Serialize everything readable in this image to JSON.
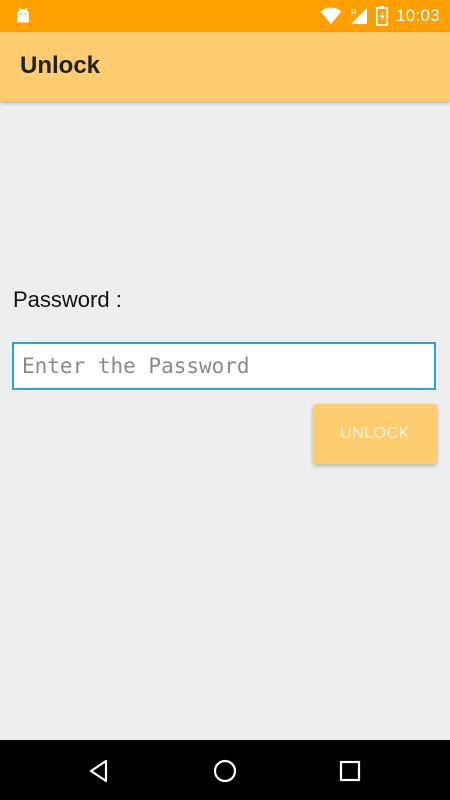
{
  "status_bar": {
    "time": "10:03",
    "icons": [
      "android-debug-icon",
      "wifi-icon",
      "signal-roaming-icon",
      "battery-icon"
    ],
    "background": "#ffa000"
  },
  "app_bar": {
    "title": "Unlock",
    "background": "#ffcc6f"
  },
  "form": {
    "password_label": "Password :",
    "password_placeholder": "Enter the Password",
    "password_value": "",
    "input_border_color": "#29a7d1",
    "unlock_label": "UNLOCK",
    "unlock_background": "#ffcc6f"
  },
  "nav_bar": {
    "buttons": [
      "back-icon",
      "home-icon",
      "recents-icon"
    ]
  }
}
